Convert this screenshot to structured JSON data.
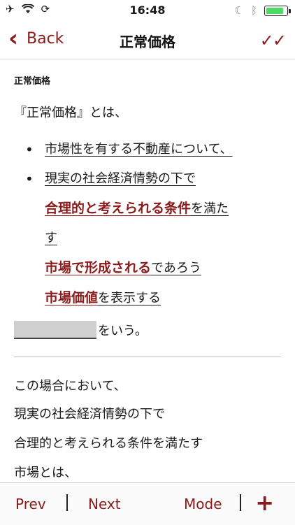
{
  "status": {
    "time": "16:48"
  },
  "nav": {
    "back": "Back",
    "title": "正常価格",
    "checks": "✓✓"
  },
  "content": {
    "section_label": "正常価格",
    "intro": "『正常価格』とは、",
    "b1": "市場性を有する不動産について、",
    "b2_line1": "現実の社会経済情勢の下で",
    "b2_em1": "合理的と考えられる条件",
    "b2_t1": "を満た",
    "b2_t2": "す",
    "b2_em2": "市場で形成される",
    "b2_t3": "であろう",
    "b2_em3": "市場価値",
    "b2_t4": "を表示する",
    "blank_suffix": "をいう。",
    "p1": "この場合において、",
    "p2": "現実の社会経済情勢の下で",
    "p3": "合理的と考えられる条件を満たす",
    "p4": "市場とは、"
  },
  "toolbar": {
    "prev": "Prev",
    "next": "Next",
    "mode": "Mode",
    "add": "+"
  }
}
